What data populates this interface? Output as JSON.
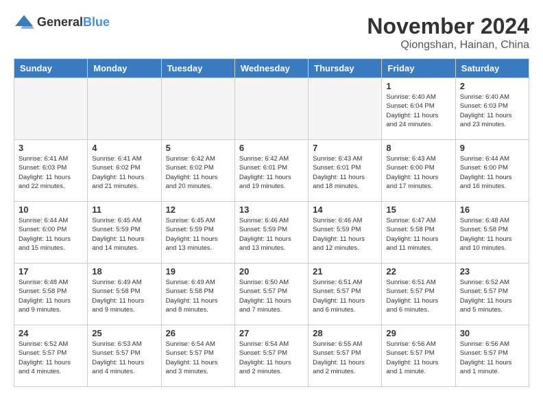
{
  "header": {
    "logo": {
      "general": "General",
      "blue": "Blue"
    },
    "title": "November 2024",
    "location": "Qiongshan, Hainan, China"
  },
  "weekdays": [
    "Sunday",
    "Monday",
    "Tuesday",
    "Wednesday",
    "Thursday",
    "Friday",
    "Saturday"
  ],
  "weeks": [
    [
      {
        "day": "",
        "sunrise": "",
        "sunset": "",
        "daylight": ""
      },
      {
        "day": "",
        "sunrise": "",
        "sunset": "",
        "daylight": ""
      },
      {
        "day": "",
        "sunrise": "",
        "sunset": "",
        "daylight": ""
      },
      {
        "day": "",
        "sunrise": "",
        "sunset": "",
        "daylight": ""
      },
      {
        "day": "",
        "sunrise": "",
        "sunset": "",
        "daylight": ""
      },
      {
        "day": "1",
        "sunrise": "Sunrise: 6:40 AM",
        "sunset": "Sunset: 6:04 PM",
        "daylight": "Daylight: 11 hours and 24 minutes."
      },
      {
        "day": "2",
        "sunrise": "Sunrise: 6:40 AM",
        "sunset": "Sunset: 6:03 PM",
        "daylight": "Daylight: 11 hours and 23 minutes."
      }
    ],
    [
      {
        "day": "3",
        "sunrise": "Sunrise: 6:41 AM",
        "sunset": "Sunset: 6:03 PM",
        "daylight": "Daylight: 11 hours and 22 minutes."
      },
      {
        "day": "4",
        "sunrise": "Sunrise: 6:41 AM",
        "sunset": "Sunset: 6:02 PM",
        "daylight": "Daylight: 11 hours and 21 minutes."
      },
      {
        "day": "5",
        "sunrise": "Sunrise: 6:42 AM",
        "sunset": "Sunset: 6:02 PM",
        "daylight": "Daylight: 11 hours and 20 minutes."
      },
      {
        "day": "6",
        "sunrise": "Sunrise: 6:42 AM",
        "sunset": "Sunset: 6:01 PM",
        "daylight": "Daylight: 11 hours and 19 minutes."
      },
      {
        "day": "7",
        "sunrise": "Sunrise: 6:43 AM",
        "sunset": "Sunset: 6:01 PM",
        "daylight": "Daylight: 11 hours and 18 minutes."
      },
      {
        "day": "8",
        "sunrise": "Sunrise: 6:43 AM",
        "sunset": "Sunset: 6:00 PM",
        "daylight": "Daylight: 11 hours and 17 minutes."
      },
      {
        "day": "9",
        "sunrise": "Sunrise: 6:44 AM",
        "sunset": "Sunset: 6:00 PM",
        "daylight": "Daylight: 11 hours and 16 minutes."
      }
    ],
    [
      {
        "day": "10",
        "sunrise": "Sunrise: 6:44 AM",
        "sunset": "Sunset: 6:00 PM",
        "daylight": "Daylight: 11 hours and 15 minutes."
      },
      {
        "day": "11",
        "sunrise": "Sunrise: 6:45 AM",
        "sunset": "Sunset: 5:59 PM",
        "daylight": "Daylight: 11 hours and 14 minutes."
      },
      {
        "day": "12",
        "sunrise": "Sunrise: 6:45 AM",
        "sunset": "Sunset: 5:59 PM",
        "daylight": "Daylight: 11 hours and 13 minutes."
      },
      {
        "day": "13",
        "sunrise": "Sunrise: 6:46 AM",
        "sunset": "Sunset: 5:59 PM",
        "daylight": "Daylight: 11 hours and 13 minutes."
      },
      {
        "day": "14",
        "sunrise": "Sunrise: 6:46 AM",
        "sunset": "Sunset: 5:59 PM",
        "daylight": "Daylight: 11 hours and 12 minutes."
      },
      {
        "day": "15",
        "sunrise": "Sunrise: 6:47 AM",
        "sunset": "Sunset: 5:58 PM",
        "daylight": "Daylight: 11 hours and 11 minutes."
      },
      {
        "day": "16",
        "sunrise": "Sunrise: 6:48 AM",
        "sunset": "Sunset: 5:58 PM",
        "daylight": "Daylight: 11 hours and 10 minutes."
      }
    ],
    [
      {
        "day": "17",
        "sunrise": "Sunrise: 6:48 AM",
        "sunset": "Sunset: 5:58 PM",
        "daylight": "Daylight: 11 hours and 9 minutes."
      },
      {
        "day": "18",
        "sunrise": "Sunrise: 6:49 AM",
        "sunset": "Sunset: 5:58 PM",
        "daylight": "Daylight: 11 hours and 9 minutes."
      },
      {
        "day": "19",
        "sunrise": "Sunrise: 6:49 AM",
        "sunset": "Sunset: 5:58 PM",
        "daylight": "Daylight: 11 hours and 8 minutes."
      },
      {
        "day": "20",
        "sunrise": "Sunrise: 6:50 AM",
        "sunset": "Sunset: 5:57 PM",
        "daylight": "Daylight: 11 hours and 7 minutes."
      },
      {
        "day": "21",
        "sunrise": "Sunrise: 6:51 AM",
        "sunset": "Sunset: 5:57 PM",
        "daylight": "Daylight: 11 hours and 6 minutes."
      },
      {
        "day": "22",
        "sunrise": "Sunrise: 6:51 AM",
        "sunset": "Sunset: 5:57 PM",
        "daylight": "Daylight: 11 hours and 6 minutes."
      },
      {
        "day": "23",
        "sunrise": "Sunrise: 6:52 AM",
        "sunset": "Sunset: 5:57 PM",
        "daylight": "Daylight: 11 hours and 5 minutes."
      }
    ],
    [
      {
        "day": "24",
        "sunrise": "Sunrise: 6:52 AM",
        "sunset": "Sunset: 5:57 PM",
        "daylight": "Daylight: 11 hours and 4 minutes."
      },
      {
        "day": "25",
        "sunrise": "Sunrise: 6:53 AM",
        "sunset": "Sunset: 5:57 PM",
        "daylight": "Daylight: 11 hours and 4 minutes."
      },
      {
        "day": "26",
        "sunrise": "Sunrise: 6:54 AM",
        "sunset": "Sunset: 5:57 PM",
        "daylight": "Daylight: 11 hours and 3 minutes."
      },
      {
        "day": "27",
        "sunrise": "Sunrise: 6:54 AM",
        "sunset": "Sunset: 5:57 PM",
        "daylight": "Daylight: 11 hours and 2 minutes."
      },
      {
        "day": "28",
        "sunrise": "Sunrise: 6:55 AM",
        "sunset": "Sunset: 5:57 PM",
        "daylight": "Daylight: 11 hours and 2 minutes."
      },
      {
        "day": "29",
        "sunrise": "Sunrise: 6:56 AM",
        "sunset": "Sunset: 5:57 PM",
        "daylight": "Daylight: 11 hours and 1 minute."
      },
      {
        "day": "30",
        "sunrise": "Sunrise: 6:56 AM",
        "sunset": "Sunset: 5:57 PM",
        "daylight": "Daylight: 11 hours and 1 minute."
      }
    ]
  ]
}
